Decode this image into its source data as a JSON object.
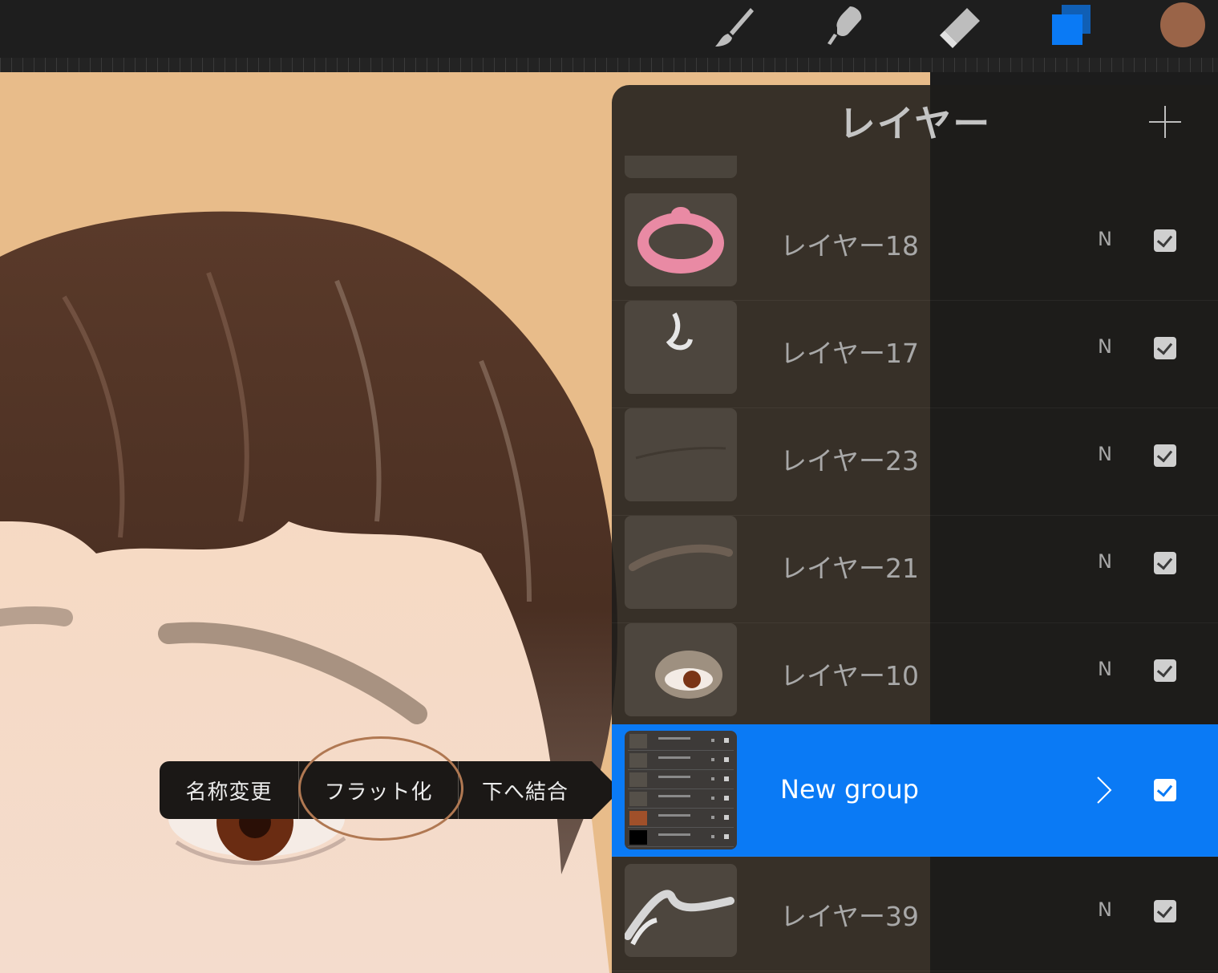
{
  "toolbar": {
    "tools": [
      "brush-icon",
      "smudge-icon",
      "eraser-icon",
      "layers-icon"
    ],
    "active_tool": "layers-icon",
    "current_color": "#9a6448"
  },
  "context_menu": {
    "items": [
      "名称変更",
      "フラット化",
      "下へ結合"
    ],
    "highlighted": "フラット化",
    "highlight_color": "#b07852"
  },
  "layers_panel": {
    "title": "レイヤー",
    "add_label": "+",
    "layers": [
      {
        "name": "レイヤー18",
        "mode": "N",
        "visible": true
      },
      {
        "name": "レイヤー17",
        "mode": "N",
        "visible": true
      },
      {
        "name": "レイヤー23",
        "mode": "N",
        "visible": true
      },
      {
        "name": "レイヤー21",
        "mode": "N",
        "visible": true
      },
      {
        "name": "レイヤー10",
        "mode": "N",
        "visible": true
      },
      {
        "name": "New group",
        "mode": "",
        "visible": true,
        "selected": true,
        "is_group": true
      },
      {
        "name": "レイヤー39",
        "mode": "N",
        "visible": true
      }
    ],
    "selected_color": "#0a7af5"
  }
}
